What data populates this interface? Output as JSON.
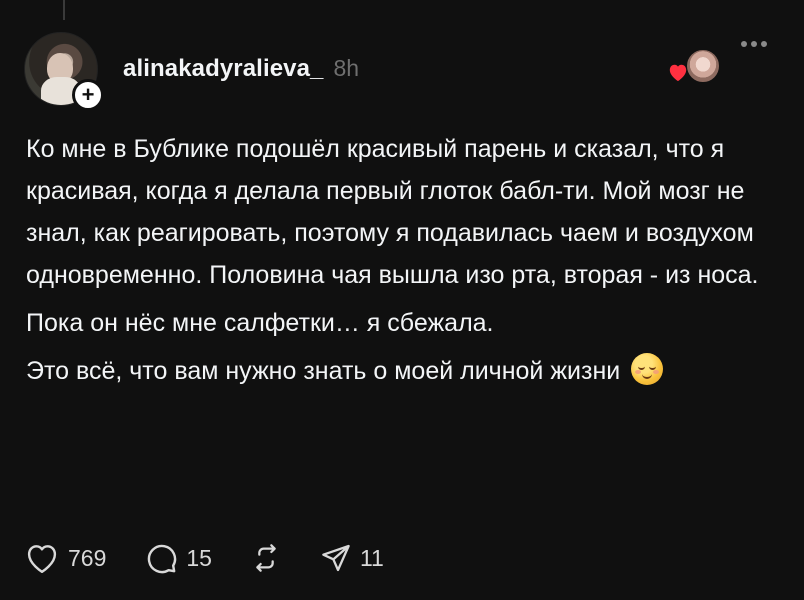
{
  "post": {
    "username": "alinakadyralieva_",
    "time": "8h",
    "paragraphs": [
      "Ко мне в Бублике подошёл красивый парень и сказал, что я красивая, когда я делала первый глоток бабл-ти. Мой мозг не знал, как реагировать, поэтому я подавилась чаем и воздухом одновременно. Половина чая вышла изо рта, вторая - из носа.",
      "Пока он нёс мне салфетки… я сбежала.",
      "Это всё, что вам нужно знать о моей личной жизни"
    ],
    "emoji": "relieved-face"
  },
  "actions": {
    "likes": "769",
    "replies": "15",
    "shares": "11"
  },
  "icons": {
    "follow": "plus-icon",
    "more": "ellipsis-icon",
    "like": "heart-icon",
    "reply": "comment-icon",
    "repost": "repost-icon",
    "share": "send-icon"
  },
  "colors": {
    "background": "#101010",
    "text": "#f3f5f7",
    "muted": "#6f6f6f",
    "like_heart": "#ff3040"
  }
}
